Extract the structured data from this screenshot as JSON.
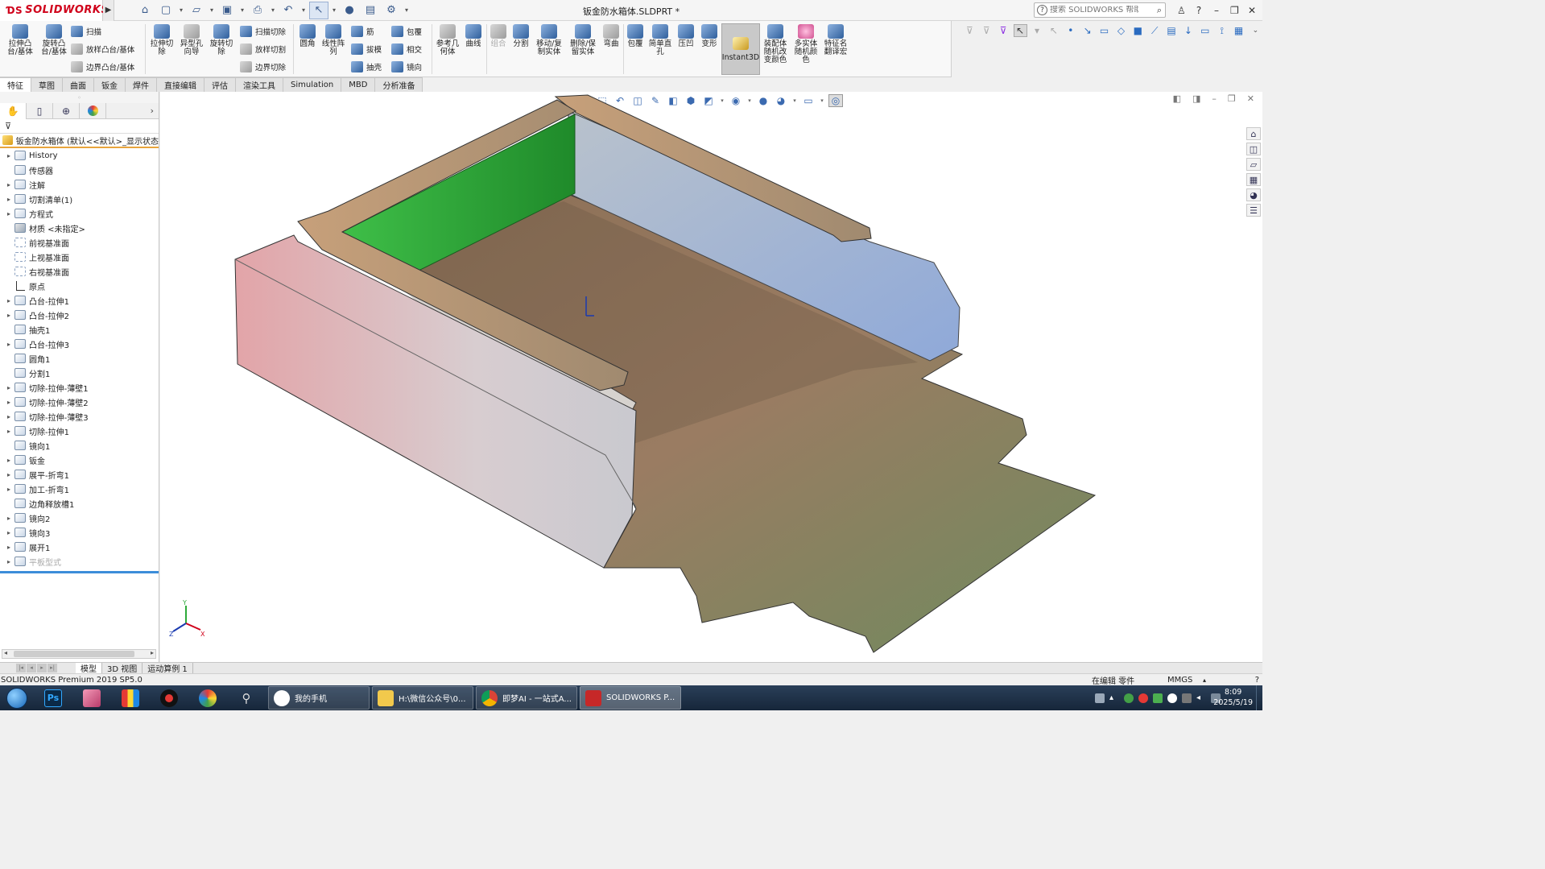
{
  "app": {
    "name": "SOLIDWORKS",
    "document_title": "钣金防水箱体.SLDPRT *"
  },
  "search": {
    "placeholder": "搜索 SOLIDWORKS 帮助"
  },
  "ribbon": {
    "extrude_boss": "拉伸凸台/基体",
    "revolve_boss": "旋转凸台/基体",
    "sweep": "扫描",
    "loft_boss": "放样凸台/基体",
    "boundary_boss": "边界凸台/基体",
    "extrude_cut": "拉伸切除",
    "hole_wizard": "异型孔向导",
    "revolve_cut": "旋转切除",
    "sweep_cut": "扫描切除",
    "loft_cut": "放样切割",
    "boundary_cut": "边界切除",
    "fillet": "圆角",
    "linear_pattern": "线性阵列",
    "rib": "筋",
    "draft": "拔模",
    "shell": "抽壳",
    "wrap": "包覆",
    "intersect": "相交",
    "mirror": "镜向",
    "ref_geometry": "参考几何体",
    "curves": "曲线",
    "combine": "组合",
    "split": "分割",
    "move_copy": "移动/复制实体",
    "delete_keep": "删除/保留实体",
    "flex": "弯曲",
    "wrap2": "包覆",
    "simple_hole": "简单直孔",
    "indent": "压凹",
    "deform": "变形",
    "instant3d": "Instant3D",
    "asm_color": "装配体随机改变颜色",
    "multi_color": "多实体随机颜色",
    "feature_translate": "特征名翻译宏"
  },
  "tabs": [
    "特征",
    "草图",
    "曲面",
    "钣金",
    "焊件",
    "直接编辑",
    "评估",
    "渲染工具",
    "Simulation",
    "MBD",
    "分析准备"
  ],
  "feature_tree": {
    "root": "钣金防水箱体 (默认<<默认>_显示状态",
    "items": [
      {
        "label": "History",
        "exp": "▸",
        "kind": ""
      },
      {
        "label": "传感器",
        "exp": "",
        "kind": ""
      },
      {
        "label": "注解",
        "exp": "▸",
        "kind": ""
      },
      {
        "label": "切割清单(1)",
        "exp": "▸",
        "kind": ""
      },
      {
        "label": "方程式",
        "exp": "▸",
        "kind": ""
      },
      {
        "label": "材质 <未指定>",
        "exp": "",
        "kind": "mat"
      },
      {
        "label": "前视基准面",
        "exp": "",
        "kind": "plane"
      },
      {
        "label": "上视基准面",
        "exp": "",
        "kind": "plane"
      },
      {
        "label": "右视基准面",
        "exp": "",
        "kind": "plane"
      },
      {
        "label": "原点",
        "exp": "",
        "kind": "origin"
      },
      {
        "label": "凸台-拉伸1",
        "exp": "▸",
        "kind": ""
      },
      {
        "label": "凸台-拉伸2",
        "exp": "▸",
        "kind": ""
      },
      {
        "label": "抽壳1",
        "exp": "",
        "kind": ""
      },
      {
        "label": "凸台-拉伸3",
        "exp": "▸",
        "kind": ""
      },
      {
        "label": "圆角1",
        "exp": "",
        "kind": ""
      },
      {
        "label": "分割1",
        "exp": "",
        "kind": ""
      },
      {
        "label": "切除-拉伸-薄壁1",
        "exp": "▸",
        "kind": ""
      },
      {
        "label": "切除-拉伸-薄壁2",
        "exp": "▸",
        "kind": ""
      },
      {
        "label": "切除-拉伸-薄壁3",
        "exp": "▸",
        "kind": ""
      },
      {
        "label": "切除-拉伸1",
        "exp": "▸",
        "kind": ""
      },
      {
        "label": "镜向1",
        "exp": "",
        "kind": ""
      },
      {
        "label": "钣金",
        "exp": "▸",
        "kind": ""
      },
      {
        "label": "展平-折弯1",
        "exp": "▸",
        "kind": ""
      },
      {
        "label": "加工-折弯1",
        "exp": "▸",
        "kind": ""
      },
      {
        "label": "边角释放槽1",
        "exp": "",
        "kind": ""
      },
      {
        "label": "镜向2",
        "exp": "▸",
        "kind": ""
      },
      {
        "label": "镜向3",
        "exp": "▸",
        "kind": ""
      },
      {
        "label": "展开1",
        "exp": "▸",
        "kind": ""
      },
      {
        "label": "平板型式",
        "exp": "▸",
        "kind": "dim"
      }
    ]
  },
  "bottom_tabs": [
    "模型",
    "3D 视图",
    "运动算例 1"
  ],
  "status": {
    "product": "SOLIDWORKS Premium 2019 SP5.0",
    "state": "在编辑 零件",
    "units": "MMGS",
    "units_caret": "▴",
    "help": "?"
  },
  "taskbar": {
    "tasks": [
      "我的手机",
      "H:\\微信公众号\\0...",
      "即梦AI - 一站式A...",
      "SOLIDWORKS P..."
    ],
    "time": "8:09",
    "date": "2025/5/19"
  },
  "colors": {
    "brand_red": "#d0021b",
    "tab_active": "#ffffff",
    "green_face": "#2fa83a"
  },
  "icons": {
    "search": "search-icon",
    "home": "home-icon",
    "filter": "filter-icon",
    "origin_triad": "triad-icon"
  }
}
